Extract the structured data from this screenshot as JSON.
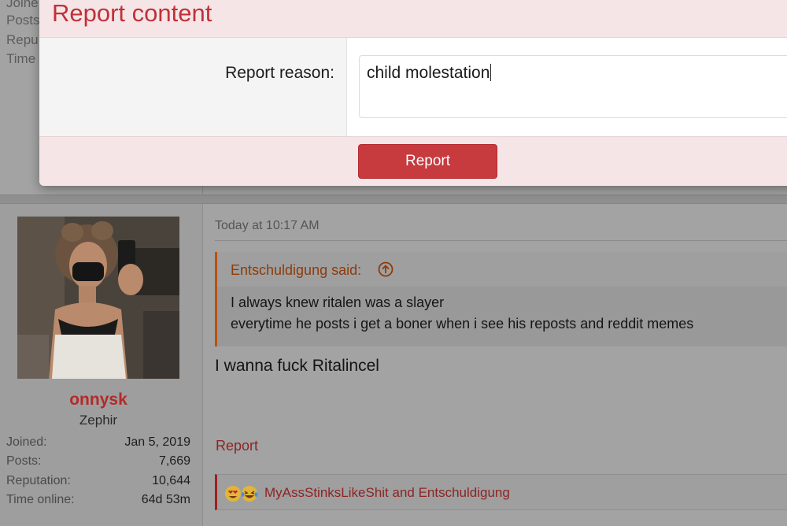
{
  "background_stats": [
    "Joine",
    "Posts",
    "Repu",
    "Time"
  ],
  "modal": {
    "title": "Report content",
    "reason_label": "Report reason:",
    "reason_value": "child molestation",
    "submit_label": "Report"
  },
  "user": {
    "name": "onnysk",
    "title": "Zephir",
    "stats": [
      {
        "label": "Joined:",
        "value": "Jan 5, 2019"
      },
      {
        "label": "Posts:",
        "value": "7,669"
      },
      {
        "label": "Reputation:",
        "value": "10,644"
      },
      {
        "label": "Time online:",
        "value": "64d 53m"
      }
    ]
  },
  "post": {
    "date": "Today at 10:17 AM",
    "quote": {
      "author": "Entschuldigung said:",
      "lines": [
        "I always knew ritalen was a slayer",
        "everytime he posts i get a boner when i see his reposts and reddit memes"
      ]
    },
    "text": "I wanna fuck Ritalincel",
    "report_label": "Report",
    "reactions": {
      "icons": [
        "heart-eyes-emoji-icon",
        "laughing-crying-emoji-icon"
      ],
      "text": "MyAssStinksLikeShit and Entschuldigung"
    }
  },
  "colors": {
    "accent": "#c73a3e",
    "modal_header": "#f6e5e6",
    "quote_border": "#b8520f"
  }
}
